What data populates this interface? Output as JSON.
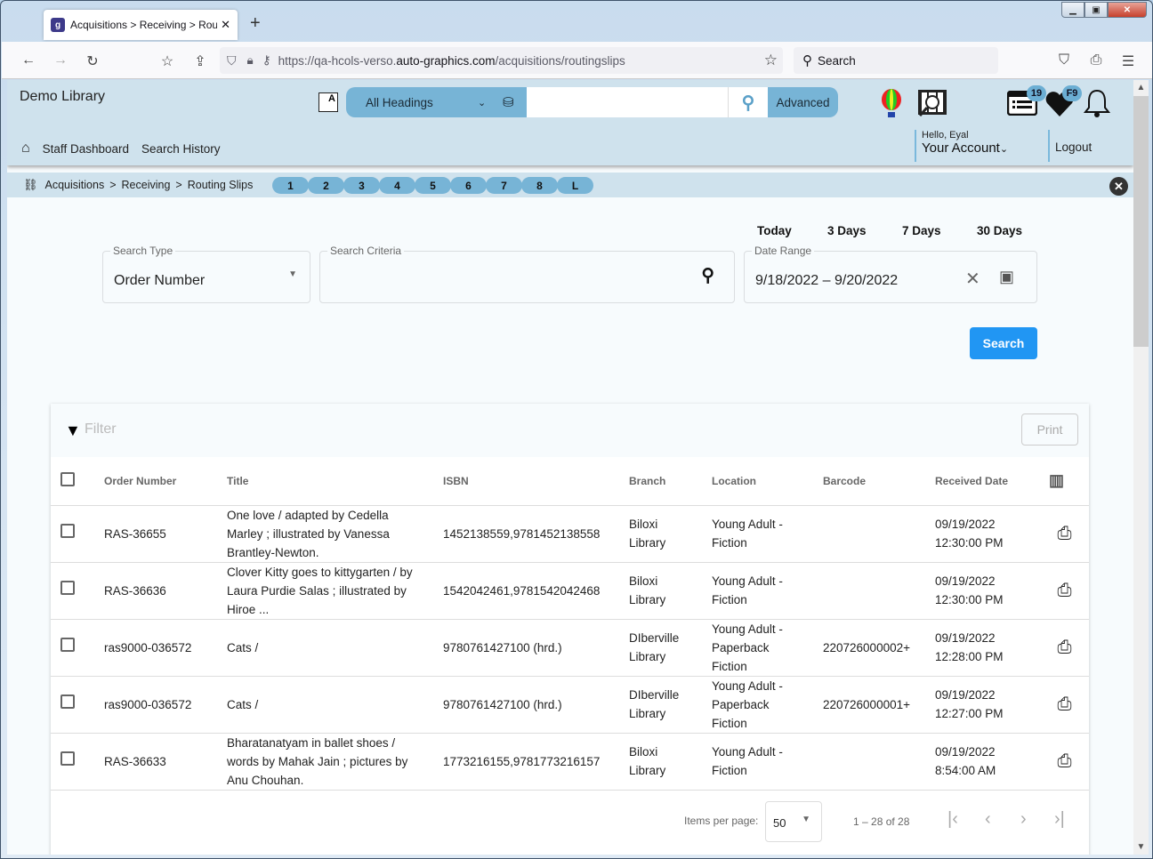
{
  "browser": {
    "tab_title": "Acquisitions > Receiving > Routing Slips",
    "tab_favicon_letters": "g",
    "url_prefix": "https://qa-hcols-verso.",
    "url_domain": "auto-graphics.com",
    "url_path": "/acquisitions/routingslips",
    "search_placeholder": "Search",
    "window_controls": [
      "minimize",
      "maximize",
      "close"
    ]
  },
  "header": {
    "library_name": "Demo Library",
    "heading_select": "All Headings",
    "search_value": "",
    "advanced_label": "Advanced",
    "list_badge": "19",
    "favorites_badge": "F9",
    "nav_items": [
      "Staff Dashboard",
      "Search History"
    ],
    "greeting": "Hello, Eyal",
    "account_label": "Your Account",
    "logout_label": "Logout"
  },
  "breadcrumb": {
    "items": [
      "Acquisitions",
      "Receiving",
      "Routing Slips"
    ],
    "separator": ">",
    "pills": [
      "1",
      "2",
      "3",
      "4",
      "5",
      "6",
      "7",
      "8",
      "L"
    ]
  },
  "search_form": {
    "quick_ranges": [
      "Today",
      "3 Days",
      "7 Days",
      "30 Days"
    ],
    "search_type_label": "Search Type",
    "search_type_value": "Order Number",
    "criteria_label": "Search Criteria",
    "criteria_value": "",
    "date_range_label": "Date Range",
    "date_range_value": "9/18/2022 – 9/20/2022",
    "search_button": "Search"
  },
  "results": {
    "filter_placeholder": "Filter",
    "print_button": "Print",
    "columns": [
      "Order Number",
      "Title",
      "ISBN",
      "Branch",
      "Location",
      "Barcode",
      "Received Date"
    ],
    "rows": [
      {
        "order": "RAS-36655",
        "title": "One love / adapted by Cedella Marley ; illustrated by Vanessa Brantley-Newton.",
        "isbn": "1452138559,9781452138558",
        "branch": "Biloxi Library",
        "location": "Young Adult - Fiction",
        "barcode": "",
        "date": "09/19/2022",
        "time": "12:30:00 PM"
      },
      {
        "order": "RAS-36636",
        "title": "Clover Kitty goes to kittygarten / by Laura Purdie Salas ; illustrated by Hiroe ...",
        "isbn": "1542042461,9781542042468",
        "branch": "Biloxi Library",
        "location": "Young Adult - Fiction",
        "barcode": "",
        "date": "09/19/2022",
        "time": "12:30:00 PM"
      },
      {
        "order": "ras9000-036572",
        "title": "Cats /",
        "isbn": "9780761427100 (hrd.)",
        "branch": "DIberville Library",
        "location": "Young Adult - Paperback Fiction",
        "barcode": "220726000002+",
        "date": "09/19/2022",
        "time": "12:28:00 PM"
      },
      {
        "order": "ras9000-036572",
        "title": "Cats /",
        "isbn": "9780761427100 (hrd.)",
        "branch": "DIberville Library",
        "location": "Young Adult - Paperback Fiction",
        "barcode": "220726000001+",
        "date": "09/19/2022",
        "time": "12:27:00 PM"
      },
      {
        "order": "RAS-36633",
        "title": "Bharatanatyam in ballet shoes / words by Mahak Jain ; pictures by Anu Chouhan.",
        "isbn": "1773216155,9781773216157",
        "branch": "Biloxi Library",
        "location": "Young Adult - Fiction",
        "barcode": "",
        "date": "09/19/2022",
        "time": "8:54:00 AM"
      }
    ],
    "paginator": {
      "items_per_page_label": "Items per page:",
      "items_per_page": "50",
      "range_label": "1 – 28 of 28"
    }
  }
}
